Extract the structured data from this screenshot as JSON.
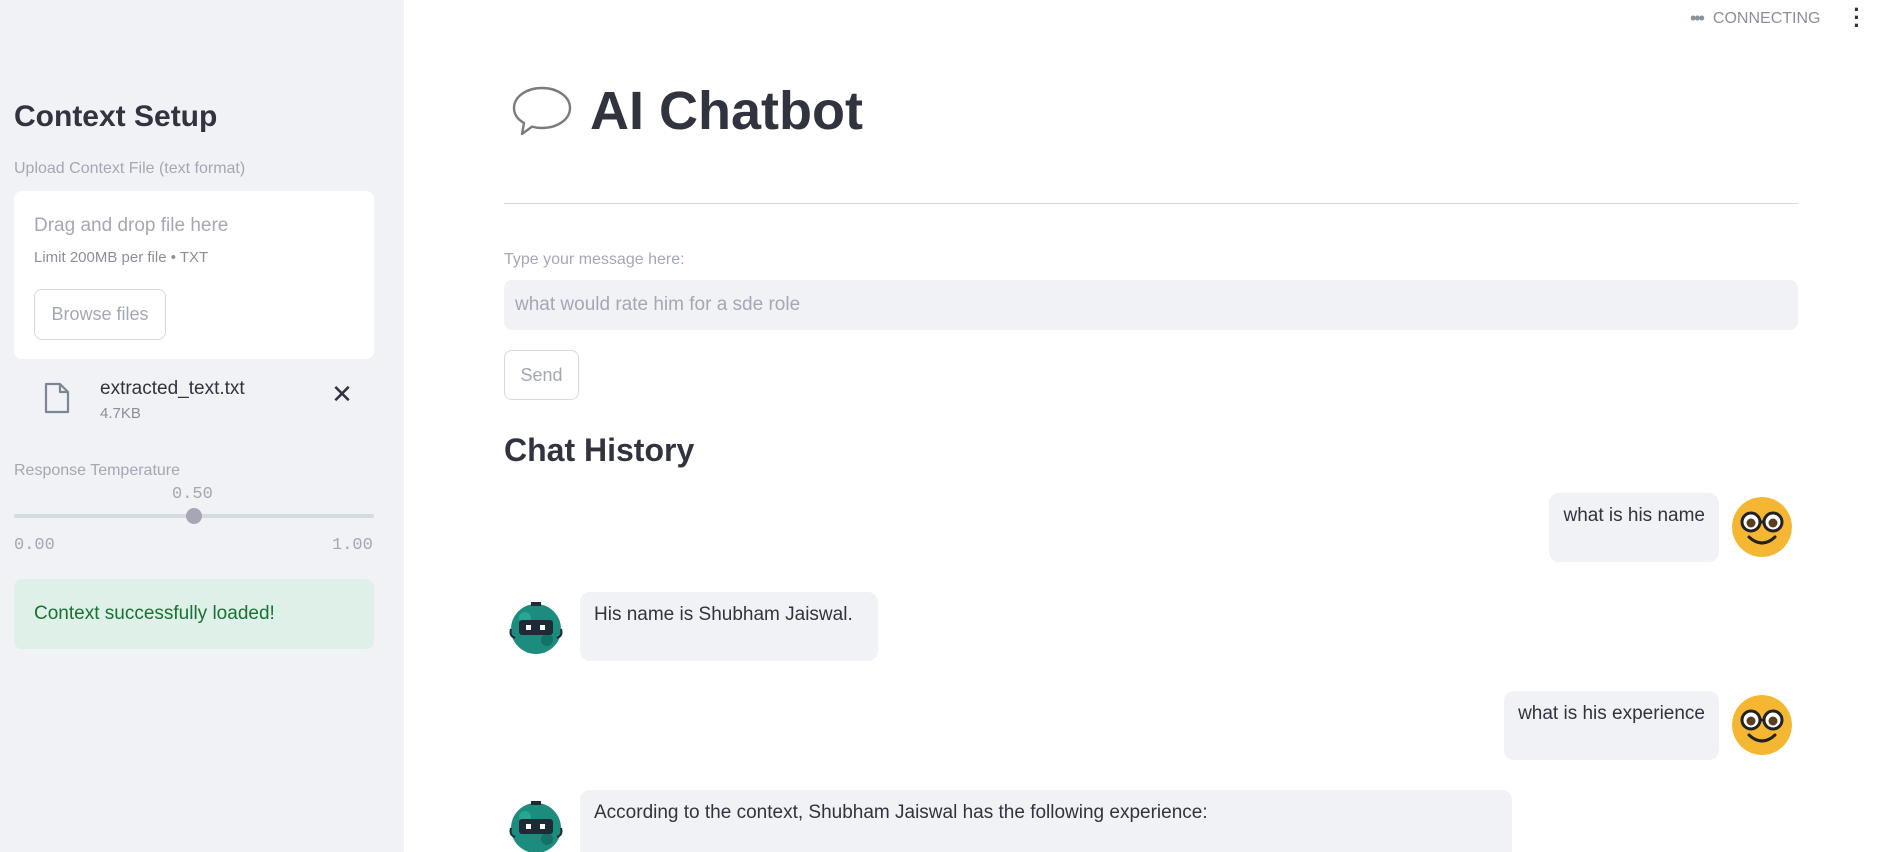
{
  "sidebar": {
    "title": "Context Setup",
    "upload_label": "Upload Context File (text format)",
    "drag_text": "Drag and drop file here",
    "limit_text": "Limit 200MB per file • TXT",
    "browse_label": "Browse files",
    "file": {
      "name": "extracted_text.txt",
      "size": "4.7KB"
    },
    "temperature": {
      "label": "Response Temperature",
      "value": 0.5,
      "value_text": "0.50",
      "min": "0.00",
      "max": "1.00"
    },
    "success_text": "Context successfully loaded!"
  },
  "status": {
    "text": "CONNECTING"
  },
  "main": {
    "title": "AI Chatbot",
    "input_label": "Type your message here:",
    "input_placeholder": "what would rate him for a sde role",
    "send_label": "Send",
    "history_title": "Chat History",
    "messages": [
      {
        "role": "user",
        "text": "what is his name"
      },
      {
        "role": "bot",
        "text": "His name is Shubham Jaiswal."
      },
      {
        "role": "user",
        "text": "what is his experience"
      },
      {
        "role": "bot",
        "text": "According to the context, Shubham Jaiswal has the following experience:"
      }
    ]
  },
  "colors": {
    "accent_success": "#177233",
    "bubble_bg": "#f0f2f6",
    "sidebar_bg": "#f0f2f6"
  }
}
